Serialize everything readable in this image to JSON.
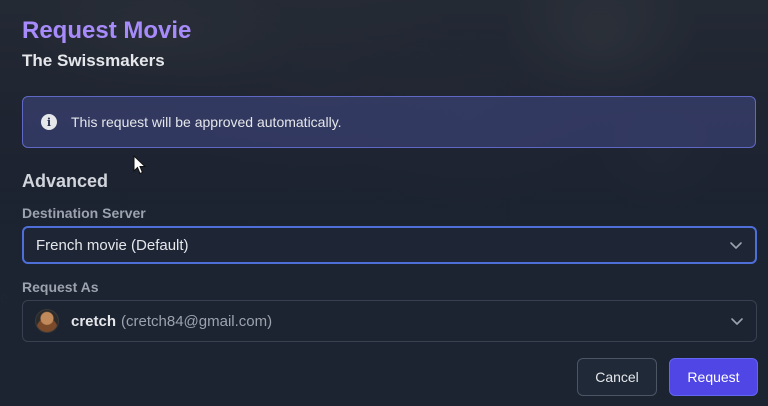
{
  "modal": {
    "title": "Request Movie",
    "subtitle": "The Swissmakers"
  },
  "alert": {
    "icon": "info-icon",
    "text": "This request will be approved automatically."
  },
  "advanced": {
    "heading": "Advanced",
    "destination_server": {
      "label": "Destination Server",
      "value": "French movie (Default)"
    },
    "request_as": {
      "label": "Request As",
      "user_name": "cretch",
      "user_email": "(cretch84@gmail.com)"
    }
  },
  "actions": {
    "cancel_label": "Cancel",
    "request_label": "Request"
  },
  "background_edge_char": "e",
  "colors": {
    "title": "#a78bfa",
    "accent": "#4f46e5",
    "focus_border": "#4f6fd8",
    "alert_border": "#5f68c4"
  }
}
